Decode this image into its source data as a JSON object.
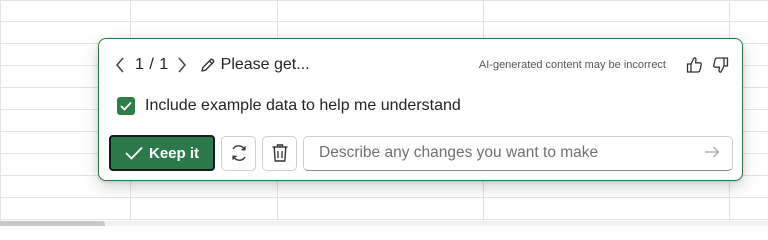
{
  "nav": {
    "pager": "1 / 1",
    "prompt_title": "Please get..."
  },
  "disclaimer": "AI-generated content may be incorrect",
  "option": {
    "label": "Include example data to help me understand",
    "checked": true
  },
  "actions": {
    "keep_label": "Keep it",
    "input_placeholder": "Describe any changes you want to make",
    "input_value": ""
  },
  "colors": {
    "accent": "#2c7a4b",
    "border": "#2b7a45"
  },
  "icons": [
    "chevron-left-icon",
    "chevron-right-icon",
    "pencil-icon",
    "thumbs-up-icon",
    "thumbs-down-icon",
    "checkmark-icon",
    "refresh-icon",
    "trash-icon",
    "send-arrow-icon"
  ]
}
